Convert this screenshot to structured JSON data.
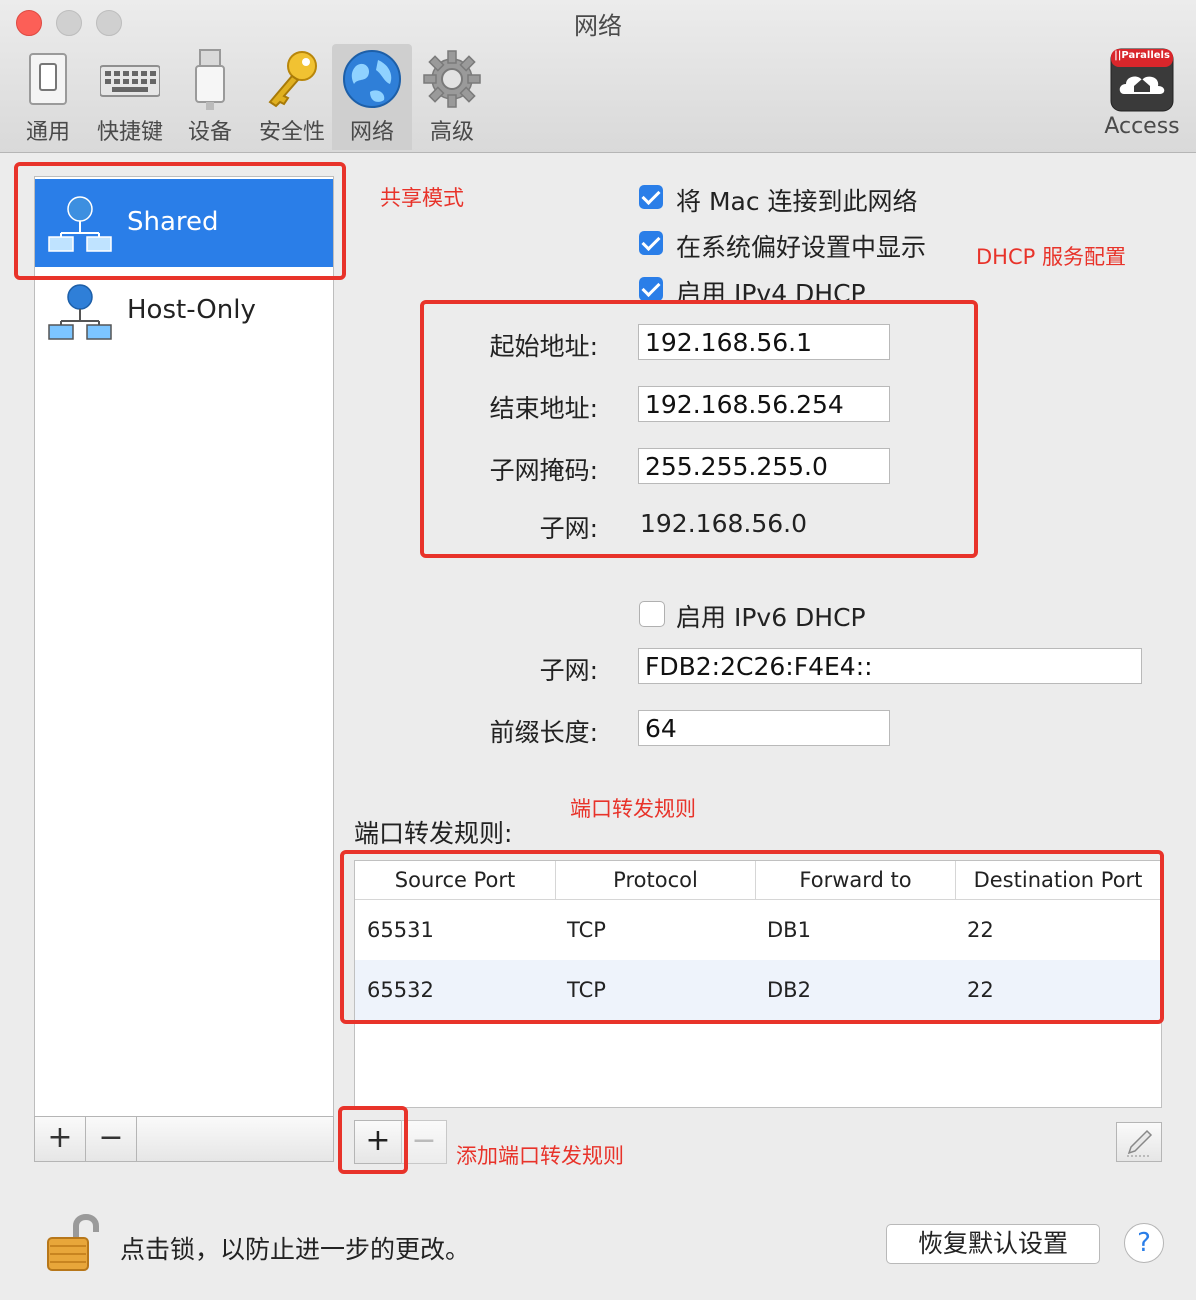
{
  "window": {
    "title": "网络"
  },
  "toolbar": {
    "items": [
      {
        "label": "通用",
        "icon": "switch-icon"
      },
      {
        "label": "快捷键",
        "icon": "keyboard-icon"
      },
      {
        "label": "设备",
        "icon": "usb-icon"
      },
      {
        "label": "安全性",
        "icon": "key-icon"
      },
      {
        "label": "网络",
        "icon": "globe-icon",
        "active": true
      },
      {
        "label": "高级",
        "icon": "gear-icon"
      }
    ],
    "access": {
      "brand": "||Parallels",
      "label": "Access",
      "icon": "home-cloud-icon"
    }
  },
  "sidebar": {
    "items": [
      {
        "label": "Shared",
        "selected": true
      },
      {
        "label": "Host-Only",
        "selected": false
      }
    ],
    "add_label": "+",
    "remove_label": "−"
  },
  "settings": {
    "connect_mac": {
      "label": "将 Mac 连接到此网络",
      "checked": true
    },
    "show_prefs": {
      "label": "在系统偏好设置中显示",
      "checked": true
    },
    "ipv4_dhcp": {
      "label": "启用 IPv4 DHCP",
      "checked": true
    },
    "start_addr": {
      "label": "起始地址:",
      "value": "192.168.56.1"
    },
    "end_addr": {
      "label": "结束地址:",
      "value": "192.168.56.254"
    },
    "subnet_mask": {
      "label": "子网掩码:",
      "value": "255.255.255.0"
    },
    "subnet": {
      "label": "子网:",
      "value": "192.168.56.0"
    },
    "ipv6_dhcp": {
      "label": "启用 IPv6 DHCP",
      "checked": false
    },
    "ipv6_subnet": {
      "label": "子网:",
      "value": "FDB2:2C26:F4E4::"
    },
    "prefix_len": {
      "label": "前缀长度:",
      "value": "64"
    }
  },
  "port_forwarding": {
    "title": "端口转发规则:",
    "columns": [
      "Source Port",
      "Protocol",
      "Forward to",
      "Destination Port"
    ],
    "rows": [
      [
        "65531",
        "TCP",
        "DB1",
        "22"
      ],
      [
        "65532",
        "TCP",
        "DB2",
        "22"
      ]
    ],
    "add_label": "+",
    "remove_label": "−"
  },
  "annotations": {
    "shared_mode": "共享模式",
    "dhcp_config": "DHCP 服务配置",
    "port_rules": "端口转发规则",
    "add_rule": "添加端口转发规则"
  },
  "footer": {
    "lock_text": "点击锁，以防止进一步的更改。",
    "restore_label": "恢复默认设置",
    "help_label": "?"
  },
  "colors": {
    "accent": "#2a7ee8",
    "annotation": "#e8332a"
  }
}
